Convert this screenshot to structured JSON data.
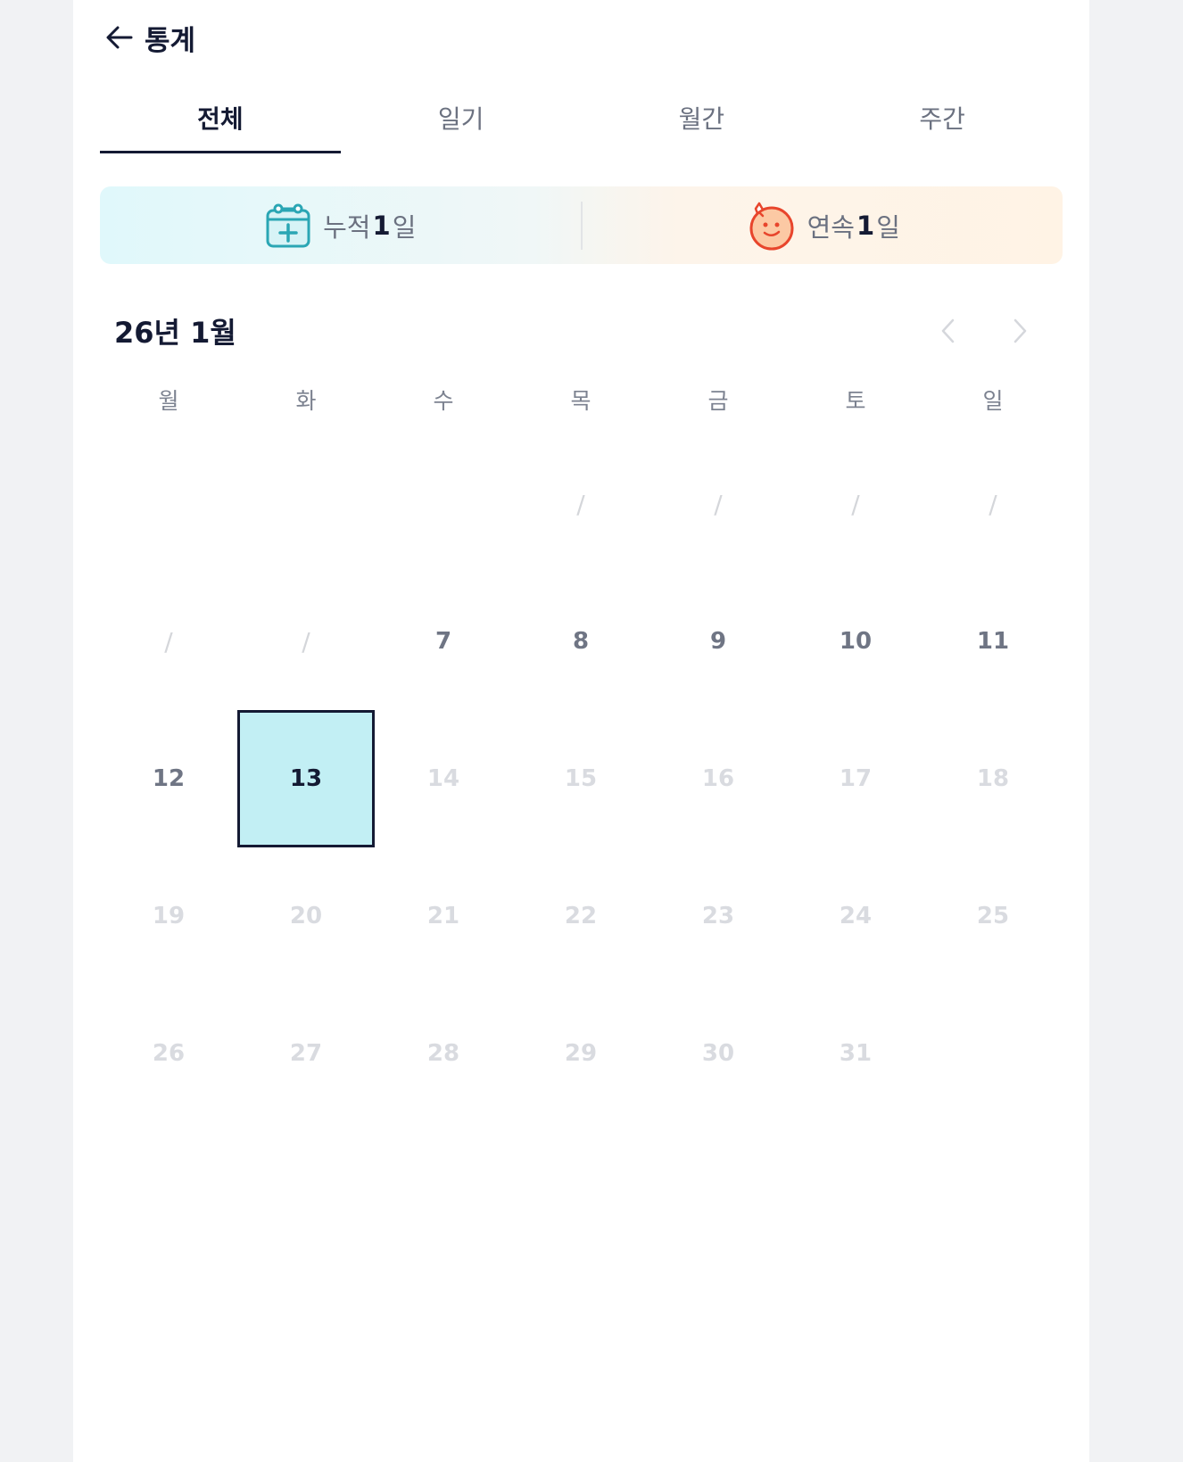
{
  "header": {
    "title": "통계",
    "back_icon": "arrow-left-icon"
  },
  "tabs": [
    {
      "label": "전체",
      "active": true
    },
    {
      "label": "일기",
      "active": false
    },
    {
      "label": "월간",
      "active": false
    },
    {
      "label": "주간",
      "active": false
    }
  ],
  "stats": {
    "cumulative": {
      "prefix": "누적",
      "value": "1",
      "suffix": "일",
      "icon": "calendar-plus-icon"
    },
    "streak": {
      "prefix": "연속",
      "value": "1",
      "suffix": "일",
      "icon": "smiley-face-icon"
    }
  },
  "calendar": {
    "month_label": "26년 1월",
    "weekdays": [
      "월",
      "화",
      "수",
      "목",
      "금",
      "토",
      "일"
    ],
    "weeks": [
      [
        "",
        "",
        "",
        "/",
        "/",
        "/",
        "/"
      ],
      [
        "/",
        "/",
        "7",
        "8",
        "9",
        "10",
        "11"
      ],
      [
        "12",
        "13",
        "14",
        "15",
        "16",
        "17",
        "18"
      ],
      [
        "19",
        "20",
        "21",
        "22",
        "23",
        "24",
        "25"
      ],
      [
        "26",
        "27",
        "28",
        "29",
        "30",
        "31",
        ""
      ]
    ],
    "today": "13",
    "last_active_day": 13
  },
  "colors": {
    "accent": "#141a33",
    "today_bg": "#c2eff4",
    "icon_teal": "#2aa6b4",
    "icon_red": "#e8452c",
    "face_fill": "#fcc9a4"
  }
}
